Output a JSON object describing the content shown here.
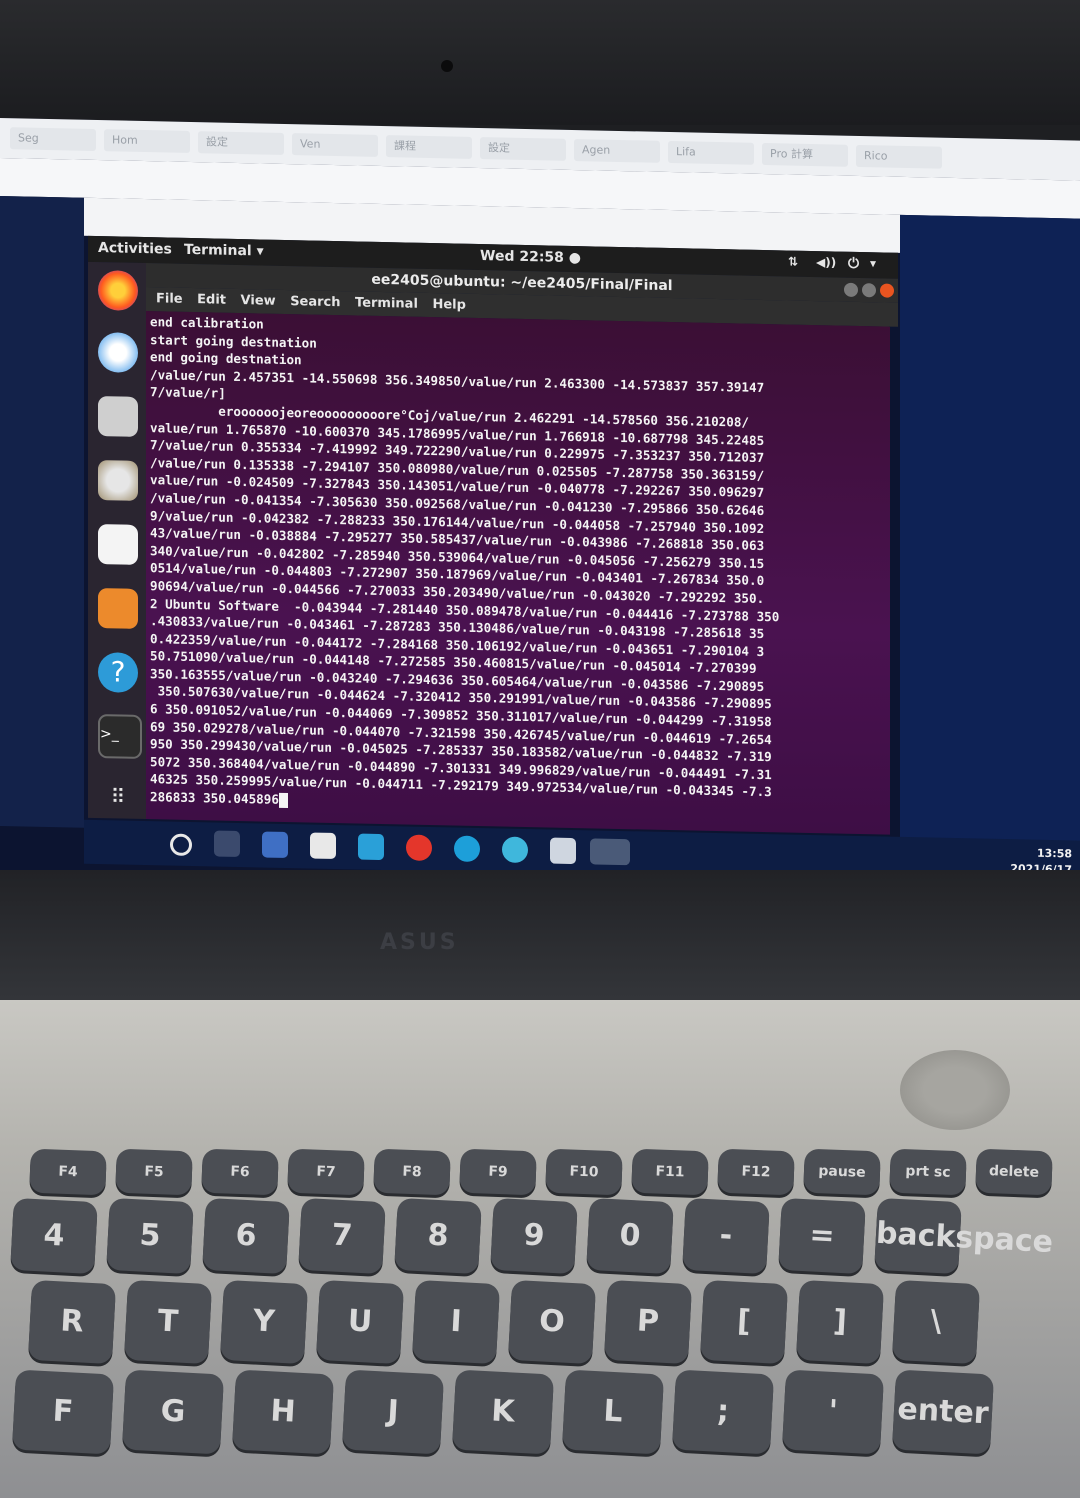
{
  "browser_tabs": [
    "Seg",
    "Hom",
    "設定",
    "Ven",
    "課程",
    "設定",
    "Agen",
    "Lifa",
    "Pro 計算",
    "Rico"
  ],
  "gnome_bar": {
    "activities": "Activities",
    "app_menu": "Terminal ▾",
    "clock": "Wed 22:58 ●"
  },
  "terminal": {
    "title": "ee2405@ubuntu: ~/ee2405/Final/Final",
    "menu": [
      "File",
      "Edit",
      "View",
      "Search",
      "Terminal",
      "Help"
    ],
    "lines": [
      "end calibration",
      "start going destnation",
      "end going destnation",
      "/value/run 2.457351 -14.550698 356.349850/value/run 2.463300 -14.573837 357.39147",
      "7/value/r]",
      "         eroooooojeoreooooooooore°Coj/value/run 2.462291 -14.578560 356.210208/",
      "value/run 1.765870 -10.600370 345.1786995/value/run 1.766918 -10.687798 345.22485",
      "7/value/run 0.355334 -7.419992 349.722290/value/run 0.229975 -7.353237 350.712037",
      "/value/run 0.135338 -7.294107 350.080980/value/run 0.025505 -7.287758 350.363159/",
      "value/run -0.024509 -7.327843 350.143051/value/run -0.040778 -7.292267 350.096297",
      "/value/run -0.041354 -7.305630 350.092568/value/run -0.041230 -7.295866 350.62646",
      "9/value/run -0.042382 -7.288233 350.176144/value/run -0.044058 -7.257940 350.1092",
      "43/value/run -0.038884 -7.295277 350.585437/value/run -0.043986 -7.268818 350.063",
      "340/value/run -0.042802 -7.285940 350.539064/value/run -0.045056 -7.256279 350.15",
      "0514/value/run -0.044803 -7.272907 350.187969/value/run -0.043401 -7.267834 350.0",
      "90694/value/run -0.044566 -7.270033 350.203490/value/run -0.043020 -7.292292 350.",
      "2 Ubuntu Software  -0.043944 -7.281440 350.089478/value/run -0.044416 -7.273788 350",
      ".430833/value/run -0.043461 -7.287283 350.130486/value/run -0.043198 -7.285618 35",
      "0.422359/value/run -0.044172 -7.284168 350.106192/value/run -0.043651 -7.290104 3",
      "50.751090/value/run -0.044148 -7.272585 350.460815/value/run -0.045014 -7.270399",
      "350.163555/value/run -0.043240 -7.294636 350.605464/value/run -0.043586 -7.290895",
      " 350.507630/value/run -0.044624 -7.320412 350.291991/value/run -0.043586 -7.290895",
      "6 350.091052/value/run -0.044069 -7.309852 350.311017/value/run -0.044299 -7.31958",
      "69 350.029278/value/run -0.044070 -7.321598 350.426745/value/run -0.044619 -7.2654",
      "950 350.299430/value/run -0.045025 -7.285337 350.183582/value/run -0.044832 -7.319",
      "5072 350.368404/value/run -0.044890 -7.301331 349.996829/value/run -0.044491 -7.31",
      "46325 350.259995/value/run -0.044711 -7.292179 349.972534/value/run -0.043345 -7.3",
      "286833 350.045896"
    ]
  },
  "taskbar": {
    "tray_time": "13:58",
    "tray_date": "2021/6/17"
  },
  "keyboard": {
    "fn_row": [
      "F4",
      "F5",
      "F6",
      "F7",
      "F8",
      "F9",
      "F10",
      "F11",
      "F12",
      "pause break",
      "prt sc sysrq",
      "delete"
    ],
    "number_row": [
      "4",
      "5",
      "6",
      "7",
      "8",
      "9",
      "0",
      "-",
      "=",
      "backspace"
    ],
    "letter_row_1": [
      "R",
      "T",
      "Y",
      "U",
      "I",
      "O",
      "P",
      "[",
      "]",
      "\\"
    ],
    "letter_row_2": [
      "F",
      "G",
      "H",
      "J",
      "K",
      "L",
      ";",
      "'",
      "enter"
    ]
  },
  "colors": {
    "terminal_bg": "#4a1250",
    "terminal_fg": "#f4f4f4",
    "desktop_bg": "#0e2255",
    "keycap": "#4b4e54"
  }
}
